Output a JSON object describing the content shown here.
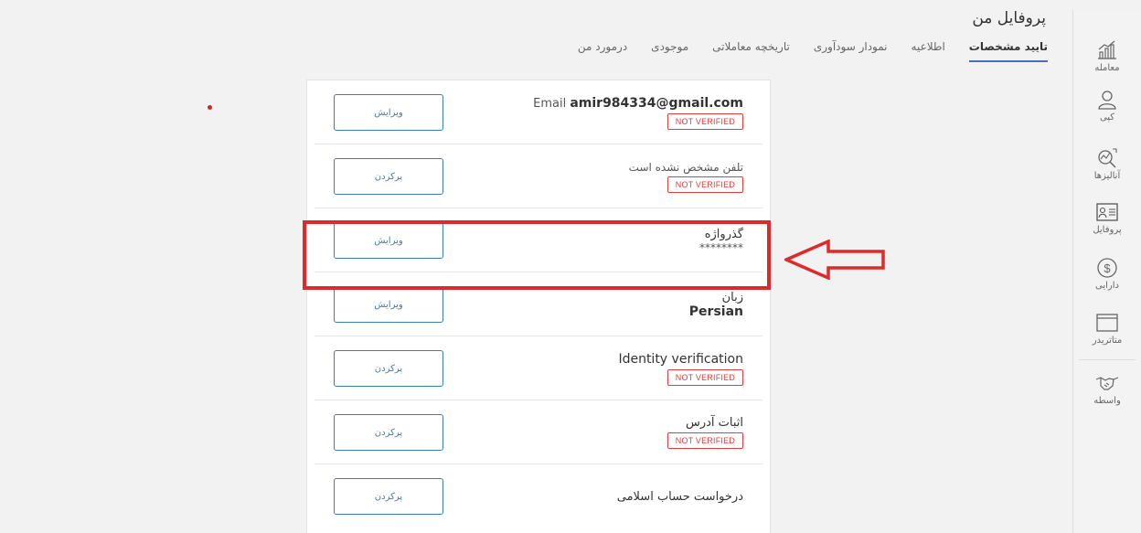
{
  "header": {
    "title": "پروفایل من",
    "tabs": [
      {
        "label": "درمورد من"
      },
      {
        "label": "موجودی"
      },
      {
        "label": "تاریخچه معاملاتی"
      },
      {
        "label": "نمودار سودآوری"
      },
      {
        "label": "اطلاعیه"
      },
      {
        "label": "تایید مشخصات"
      }
    ],
    "active_tab": "تایید مشخصات"
  },
  "sidebar": {
    "items": [
      {
        "label": "معامله",
        "icon": "chart-icon"
      },
      {
        "label": "کپی",
        "icon": "user-icon"
      },
      {
        "label": "آنالیزها",
        "icon": "analysis-icon"
      },
      {
        "label": "پروفایل",
        "icon": "profile-card-icon"
      },
      {
        "label": "دارایی",
        "icon": "dollar-icon"
      },
      {
        "label": "متاتریدر",
        "icon": "window-icon"
      },
      {
        "label": "واسطه",
        "icon": "handshake-icon"
      }
    ]
  },
  "profile": {
    "rows": [
      {
        "label_prefix": "Email",
        "value": "amir984334@gmail.com",
        "status": "NOT VERIFIED",
        "button": "ویرایش"
      },
      {
        "label": "تلفن مشخص نشده است",
        "status": "NOT VERIFIED",
        "button": "پرکردن"
      },
      {
        "label": "گذرواژه",
        "value": "********",
        "button": "ویرایش"
      },
      {
        "label": "زبان",
        "value": "Persian",
        "button": "ویرایش"
      },
      {
        "label": "Identity verification",
        "status": "NOT VERIFIED",
        "button": "پرکردن"
      },
      {
        "label": "اثبات آدرس",
        "status": "NOT VERIFIED",
        "button": "پرکردن"
      },
      {
        "label": "درخواست حساب اسلامی",
        "button": "پرکردن"
      }
    ]
  },
  "colors": {
    "accent": "#3b7db8",
    "tab_underline": "#4a6fb5",
    "highlight": "#dd2a2a",
    "badge": "#e23d3d"
  }
}
